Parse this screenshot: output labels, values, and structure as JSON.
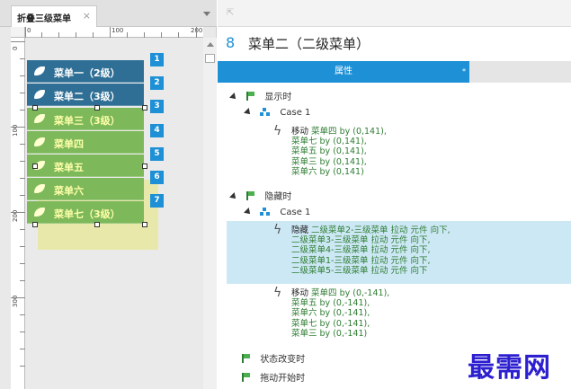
{
  "tab": {
    "title": "折叠三级菜单",
    "close": "×"
  },
  "ruler": {
    "h_labels": [
      "0",
      "100",
      "200"
    ],
    "v_labels": [
      "0",
      "100",
      "200",
      "300"
    ]
  },
  "menu_items": [
    {
      "label": "菜单一（2级）",
      "badge": "1"
    },
    {
      "label": "菜单二（3级）",
      "badge": "2"
    },
    {
      "label": "菜单三（3级）",
      "badge": "3"
    },
    {
      "label": "菜单四",
      "badge": "4"
    },
    {
      "label": "菜单五",
      "badge": "5"
    },
    {
      "label": "菜单六",
      "badge": "6"
    },
    {
      "label": "菜单七（3级）",
      "badge": "7"
    }
  ],
  "inspector": {
    "page_number": "8",
    "page_title": "菜单二（二级菜单）",
    "tab_label": "属性",
    "tab_marker": "*",
    "events": {
      "shown": "显示时",
      "hidden": "隐藏时",
      "state_change": "状态改变时",
      "drag_start": "拖动开始时"
    },
    "case1": "Case 1",
    "case2": "Case 1",
    "action1": {
      "verb": "移动",
      "lines": [
        "菜单四 by (0,141),",
        "菜单七 by (0,141),",
        "菜单五 by (0,141),",
        "菜单三 by (0,141),",
        "菜单六 by (0,141)"
      ]
    },
    "action2": {
      "verb": "隐藏",
      "lines": [
        "二级菜单2-三级菜单 拉动 元件 向下,",
        "二级菜单3-三级菜单 拉动 元件 向下,",
        "二级菜单4-三级菜单 拉动 元件 向下,",
        "二级菜单1-三级菜单 拉动 元件 向下,",
        "二级菜单5-三级菜单 拉动 元件 向下"
      ]
    },
    "action3": {
      "verb": "移动",
      "lines": [
        "菜单四 by (0,-141),",
        "菜单五 by (0,-141),",
        "菜单六 by (0,-141),",
        "菜单七 by (0,-141),",
        "菜单三 by (0,-141)"
      ]
    }
  },
  "watermark": "最需网",
  "colors": {
    "accent": "#1e90d6",
    "menu_blue": "#2f6f95",
    "menu_green": "#7db85a",
    "action_green": "#2e7d32",
    "highlight": "#cde8f5"
  }
}
